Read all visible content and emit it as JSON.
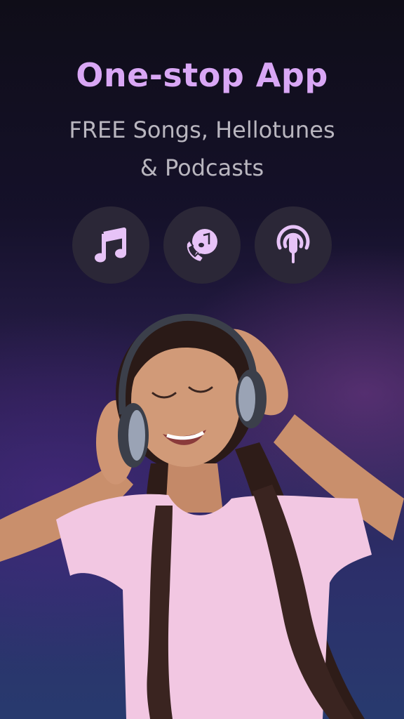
{
  "onboarding": {
    "title": "One-stop App",
    "subtitle_line1": "FREE Songs, Hellotunes",
    "subtitle_line2": "& Podcasts"
  },
  "features": [
    {
      "icon": "music-note-icon"
    },
    {
      "icon": "hellotune-phone-icon"
    },
    {
      "icon": "podcast-icon"
    }
  ],
  "hero": {
    "icon": "woman-with-headphones-illustration"
  },
  "colors": {
    "title": "#d9a7f5",
    "subtitle": "#b9b6bf",
    "icon_circle": "#2b2737",
    "icon_fill": "#e7c3f7",
    "shirt": "#f2c7e2"
  }
}
